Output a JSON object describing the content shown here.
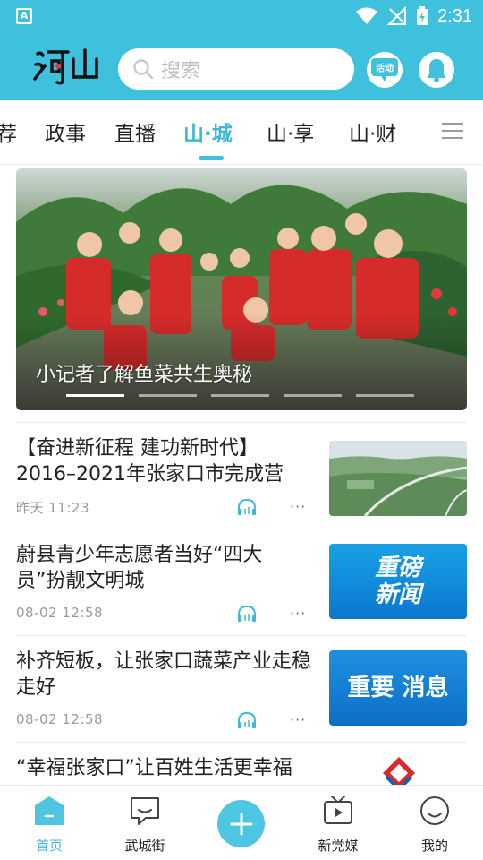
{
  "status_bar": {
    "time": "2:31"
  },
  "header": {
    "logo_text": "河山",
    "search_placeholder": "搜索",
    "activity_label": "活动"
  },
  "tabs": [
    {
      "label": "荐"
    },
    {
      "label": "政事"
    },
    {
      "label": "直播"
    },
    {
      "label": "山·城"
    },
    {
      "label": "山·享"
    },
    {
      "label": "山·财"
    }
  ],
  "active_tab_index": 3,
  "banner": {
    "caption": "小记者了解鱼菜共生奥秘",
    "slide_count": 5,
    "active_slide": 0
  },
  "news": [
    {
      "title": "【奋进新征程  建功新时代】2016–2021年张家口市完成营",
      "time": "昨天  11:23",
      "thumb": "landscape-photo"
    },
    {
      "title": "蔚县青少年志愿者当好“四大员”扮靓文明城",
      "time": "08-02  12:58",
      "thumb_text": "重磅\n新闻"
    },
    {
      "title": "补齐短板，让张家口蔬菜产业走稳走好",
      "time": "08-02  12:58",
      "thumb_text": "重要\n消息"
    },
    {
      "title": "“幸福张家口”让百姓生活更幸福",
      "thumb": "logo-image"
    }
  ],
  "bottom_nav": [
    {
      "label": "首页",
      "icon": "home-icon",
      "active": true
    },
    {
      "label": "武城街",
      "icon": "chat-icon"
    },
    {
      "label": "",
      "icon": "plus-icon"
    },
    {
      "label": "新党媒",
      "icon": "tv-icon"
    },
    {
      "label": "我的",
      "icon": "smile-icon"
    }
  ],
  "colors": {
    "accent": "#3fc1dd",
    "active_text": "#3fb8d6"
  }
}
